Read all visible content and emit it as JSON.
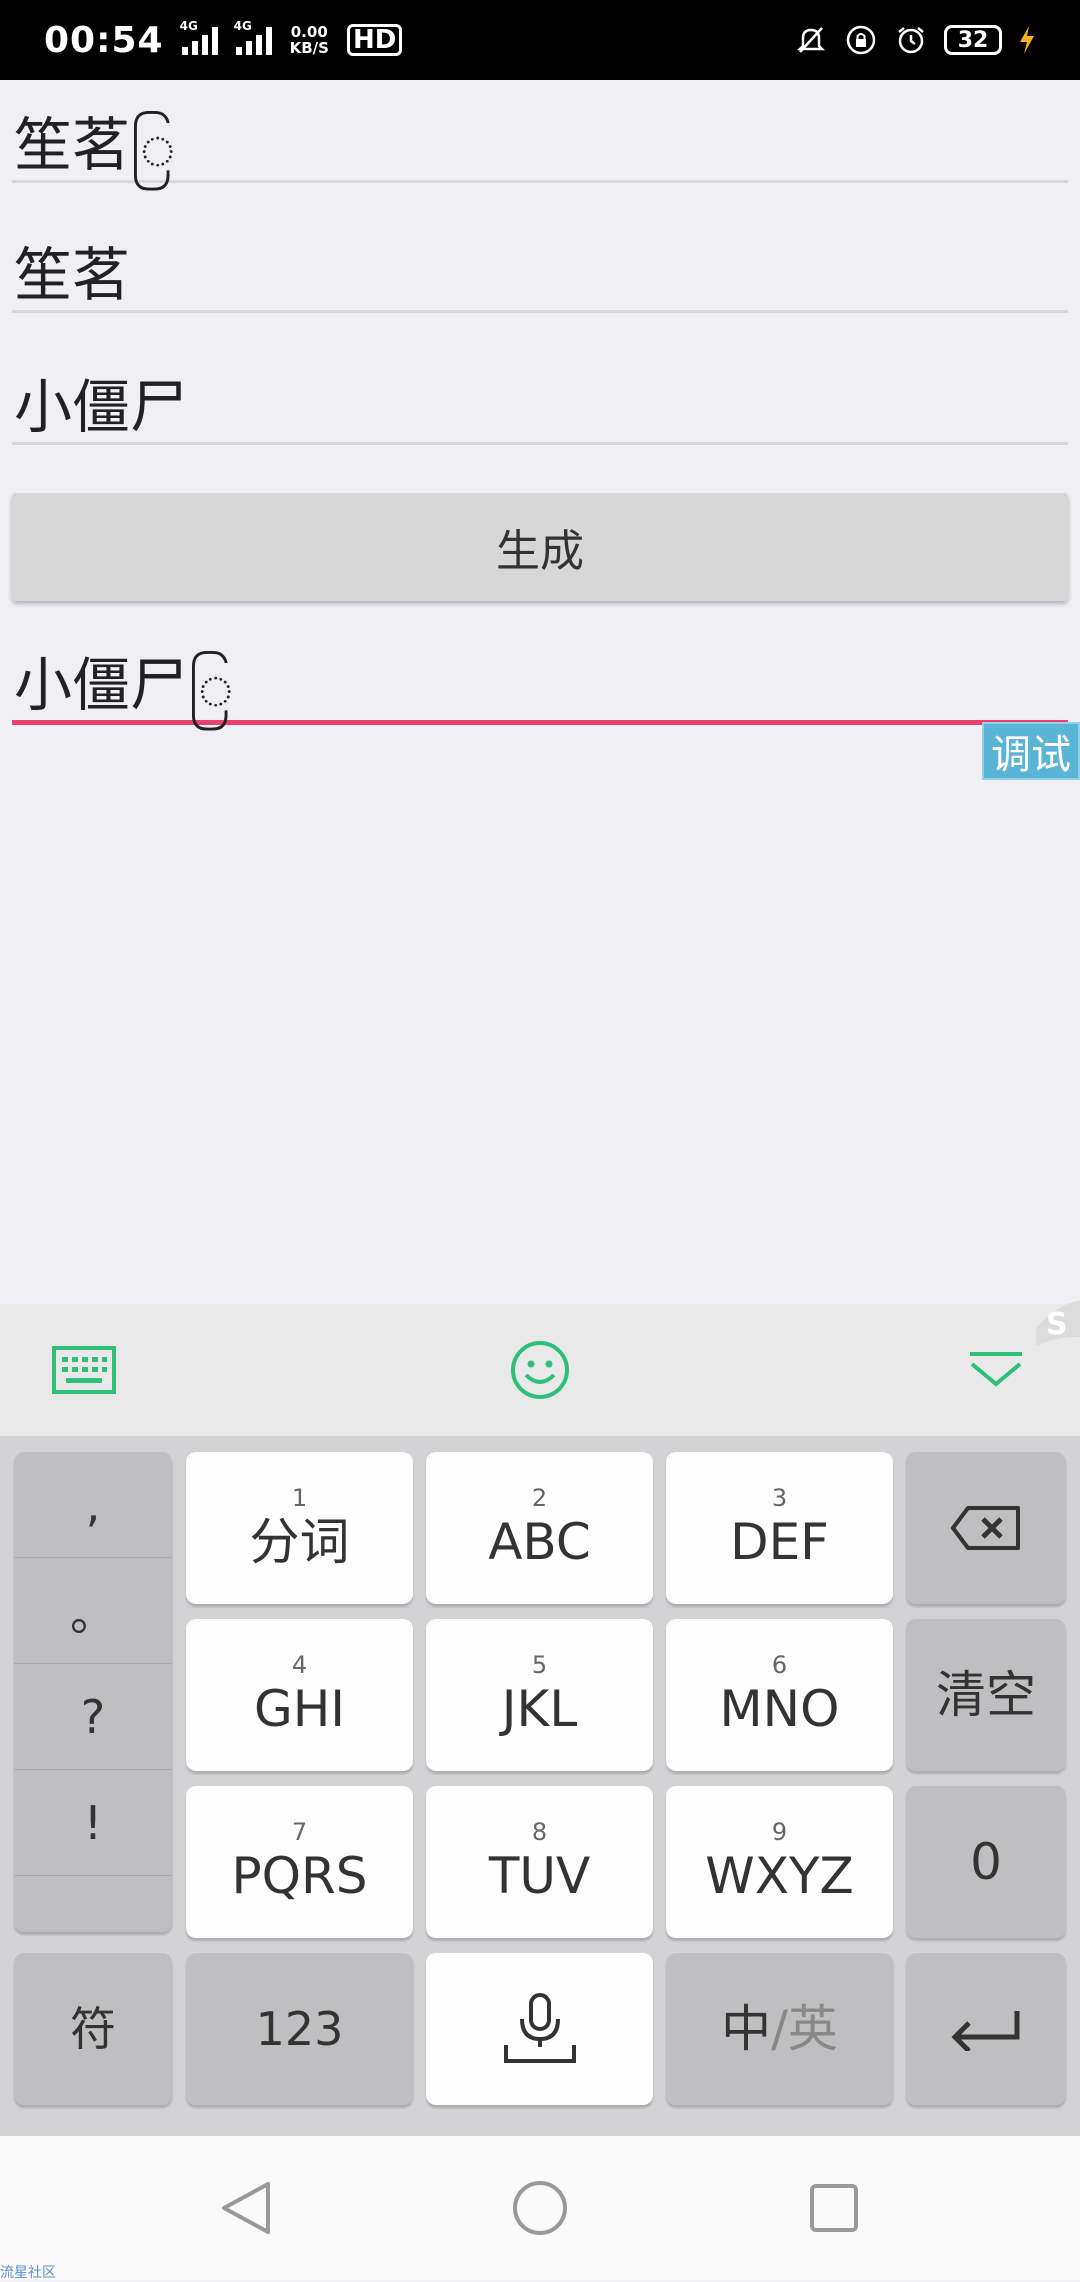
{
  "status_bar": {
    "time": "00:54",
    "net_label_1": "4G",
    "net_label_2": "4G",
    "speed_value": "0.00",
    "speed_unit": "KB/S",
    "hd": "HD",
    "battery": "32"
  },
  "form": {
    "field1": "笙茗ြ",
    "field2": "笙茗",
    "field3": "小僵尸",
    "generate_label": "生成",
    "output": "小僵尸ြ"
  },
  "debug_badge": "调试",
  "keyboard": {
    "punct": [
      ",",
      "。",
      "?",
      "!"
    ],
    "keys": [
      {
        "num": "1",
        "label": "分词"
      },
      {
        "num": "2",
        "label": "ABC"
      },
      {
        "num": "3",
        "label": "DEF"
      },
      {
        "num": "4",
        "label": "GHI"
      },
      {
        "num": "5",
        "label": "JKL"
      },
      {
        "num": "6",
        "label": "MNO"
      },
      {
        "num": "7",
        "label": "PQRS"
      },
      {
        "num": "8",
        "label": "TUV"
      },
      {
        "num": "9",
        "label": "WXYZ"
      }
    ],
    "clear": "清空",
    "zero": "0",
    "symbols": "符",
    "num_switch": "123",
    "lang_zh": "中",
    "lang_sep": "/",
    "lang_en": "英"
  },
  "watermark": "流星社区",
  "colors": {
    "accent_pink": "#e8406f",
    "accent_green": "#2fbf7a",
    "badge_blue": "#5ab4d6"
  }
}
